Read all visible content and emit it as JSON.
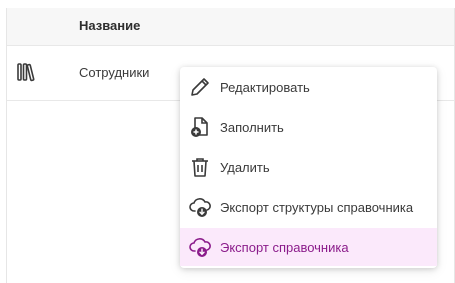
{
  "table": {
    "header": {
      "name_col": "Название"
    },
    "rows": [
      {
        "label": "Сотрудники",
        "icon": "books-icon"
      }
    ]
  },
  "menu": {
    "items": [
      {
        "label": "Редактировать",
        "icon": "pencil-icon"
      },
      {
        "label": "Заполнить",
        "icon": "file-add-icon"
      },
      {
        "label": "Удалить",
        "icon": "trash-icon"
      },
      {
        "label": "Экспорт структуры справочника",
        "icon": "cloud-download-icon"
      },
      {
        "label": "Экспорт справочника",
        "icon": "cloud-download-icon",
        "active": true
      }
    ]
  },
  "colors": {
    "active_bg": "#fbe9fb",
    "active_text": "#8b1c8b",
    "active_icon": "#8b1c8b"
  }
}
